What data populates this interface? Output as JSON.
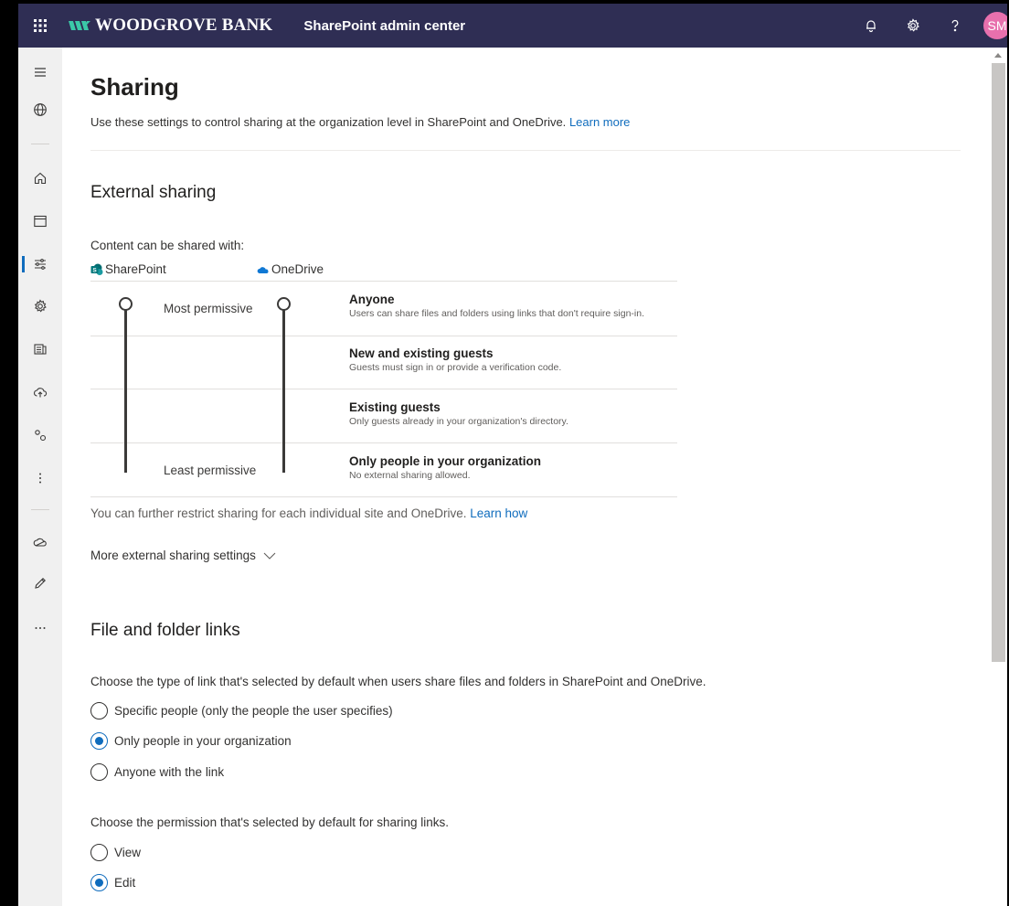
{
  "topbar": {
    "waffle_icon": "waffle-icon",
    "brand": "WOODGROVE BANK",
    "app_title": "SharePoint admin center",
    "avatar_initials": "SM",
    "icons": [
      "bell-icon",
      "gear-icon",
      "help-icon"
    ],
    "colors": {
      "bar": "#2f2e54",
      "avatar": "#e870ad"
    }
  },
  "leftnav": {
    "items": [
      "menu-icon",
      "globe-icon",
      "home-icon",
      "sites-icon",
      "policies-icon",
      "settings-icon",
      "content-services-icon",
      "migration-icon",
      "advanced-icon",
      "more-features-icon",
      "onedrive-icon",
      "edit-icon",
      "ellipsis-icon"
    ],
    "active": "policies-icon"
  },
  "page": {
    "title": "Sharing",
    "intro": "Use these settings to control sharing at the organization level in SharePoint and OneDrive.",
    "intro_link": "Learn more"
  },
  "external_sharing": {
    "heading": "External sharing",
    "content_label": "Content can be shared with:",
    "sharepoint_label": "SharePoint",
    "onedrive_label": "OneDrive",
    "most_permissive": "Most permissive",
    "least_permissive": "Least permissive",
    "sharepoint_level": "Anyone",
    "onedrive_level": "Anyone",
    "levels": [
      {
        "title": "Anyone",
        "desc": "Users can share files and folders using links that don't require sign-in."
      },
      {
        "title": "New and existing guests",
        "desc": "Guests must sign in or provide a verification code."
      },
      {
        "title": "Existing guests",
        "desc": "Only guests already in your organization's directory."
      },
      {
        "title": "Only people in your organization",
        "desc": "No external sharing allowed."
      }
    ],
    "restrict_text": "You can further restrict sharing for each individual site and OneDrive.",
    "restrict_link": "Learn how",
    "more_settings": "More external sharing settings"
  },
  "file_folder_links": {
    "heading": "File and folder links",
    "link_type_label": "Choose the type of link that's selected by default when users share files and folders in SharePoint and OneDrive.",
    "link_type_options": [
      "Specific people (only the people the user specifies)",
      "Only people in your organization",
      "Anyone with the link"
    ],
    "link_type_selected": "Only people in your organization",
    "permission_label": "Choose the permission that's selected by default for sharing links.",
    "permission_options": [
      "View",
      "Edit"
    ],
    "permission_selected": "Edit"
  },
  "accent_color": "#0f6cbd"
}
